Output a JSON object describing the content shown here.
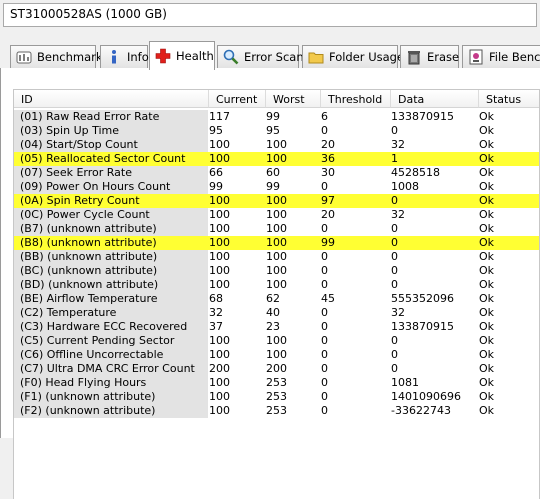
{
  "drive": {
    "selected": "ST31000528AS (1000 GB)"
  },
  "tabs": [
    {
      "label": "Benchmark",
      "icon": "benchmark-icon"
    },
    {
      "label": "Info",
      "icon": "info-icon"
    },
    {
      "label": "Health",
      "icon": "health-cross-icon"
    },
    {
      "label": "Error Scan",
      "icon": "magnifier-icon"
    },
    {
      "label": "Folder Usage",
      "icon": "folder-icon"
    },
    {
      "label": "Erase",
      "icon": "trash-icon"
    },
    {
      "label": "File Bench",
      "icon": "file-benchmark-icon"
    }
  ],
  "active_tab": "Health",
  "columns": [
    "ID",
    "Current",
    "Worst",
    "Threshold",
    "Data",
    "Status"
  ],
  "colors": {
    "highlight": "#ffff33",
    "id_column_bg": "#e3e3e3",
    "health_cross": "#e0201b"
  },
  "rows": [
    {
      "id": "(01) Raw Read Error Rate",
      "current": "117",
      "worst": "99",
      "threshold": "6",
      "data": "133870915",
      "status": "Ok",
      "highlight": false
    },
    {
      "id": "(03) Spin Up Time",
      "current": "95",
      "worst": "95",
      "threshold": "0",
      "data": "0",
      "status": "Ok",
      "highlight": false
    },
    {
      "id": "(04) Start/Stop Count",
      "current": "100",
      "worst": "100",
      "threshold": "20",
      "data": "32",
      "status": "Ok",
      "highlight": false
    },
    {
      "id": "(05) Reallocated Sector Count",
      "current": "100",
      "worst": "100",
      "threshold": "36",
      "data": "1",
      "status": "Ok",
      "highlight": true
    },
    {
      "id": "(07) Seek Error Rate",
      "current": "66",
      "worst": "60",
      "threshold": "30",
      "data": "4528518",
      "status": "Ok",
      "highlight": false
    },
    {
      "id": "(09) Power On Hours Count",
      "current": "99",
      "worst": "99",
      "threshold": "0",
      "data": "1008",
      "status": "Ok",
      "highlight": false
    },
    {
      "id": "(0A) Spin Retry Count",
      "current": "100",
      "worst": "100",
      "threshold": "97",
      "data": "0",
      "status": "Ok",
      "highlight": true
    },
    {
      "id": "(0C) Power Cycle Count",
      "current": "100",
      "worst": "100",
      "threshold": "20",
      "data": "32",
      "status": "Ok",
      "highlight": false
    },
    {
      "id": "(B7) (unknown attribute)",
      "current": "100",
      "worst": "100",
      "threshold": "0",
      "data": "0",
      "status": "Ok",
      "highlight": false
    },
    {
      "id": "(B8) (unknown attribute)",
      "current": "100",
      "worst": "100",
      "threshold": "99",
      "data": "0",
      "status": "Ok",
      "highlight": true
    },
    {
      "id": "(BB) (unknown attribute)",
      "current": "100",
      "worst": "100",
      "threshold": "0",
      "data": "0",
      "status": "Ok",
      "highlight": false
    },
    {
      "id": "(BC) (unknown attribute)",
      "current": "100",
      "worst": "100",
      "threshold": "0",
      "data": "0",
      "status": "Ok",
      "highlight": false
    },
    {
      "id": "(BD) (unknown attribute)",
      "current": "100",
      "worst": "100",
      "threshold": "0",
      "data": "0",
      "status": "Ok",
      "highlight": false
    },
    {
      "id": "(BE) Airflow Temperature",
      "current": "68",
      "worst": "62",
      "threshold": "45",
      "data": "555352096",
      "status": "Ok",
      "highlight": false
    },
    {
      "id": "(C2) Temperature",
      "current": "32",
      "worst": "40",
      "threshold": "0",
      "data": "32",
      "status": "Ok",
      "highlight": false
    },
    {
      "id": "(C3) Hardware ECC Recovered",
      "current": "37",
      "worst": "23",
      "threshold": "0",
      "data": "133870915",
      "status": "Ok",
      "highlight": false
    },
    {
      "id": "(C5) Current Pending Sector",
      "current": "100",
      "worst": "100",
      "threshold": "0",
      "data": "0",
      "status": "Ok",
      "highlight": false
    },
    {
      "id": "(C6) Offline Uncorrectable",
      "current": "100",
      "worst": "100",
      "threshold": "0",
      "data": "0",
      "status": "Ok",
      "highlight": false
    },
    {
      "id": "(C7) Ultra DMA CRC Error Count",
      "current": "200",
      "worst": "200",
      "threshold": "0",
      "data": "0",
      "status": "Ok",
      "highlight": false
    },
    {
      "id": "(F0) Head Flying Hours",
      "current": "100",
      "worst": "253",
      "threshold": "0",
      "data": "1081",
      "status": "Ok",
      "highlight": false
    },
    {
      "id": "(F1) (unknown attribute)",
      "current": "100",
      "worst": "253",
      "threshold": "0",
      "data": "1401090696",
      "status": "Ok",
      "highlight": false
    },
    {
      "id": "(F2) (unknown attribute)",
      "current": "100",
      "worst": "253",
      "threshold": "0",
      "data": "-33622743",
      "status": "Ok",
      "highlight": false
    }
  ]
}
